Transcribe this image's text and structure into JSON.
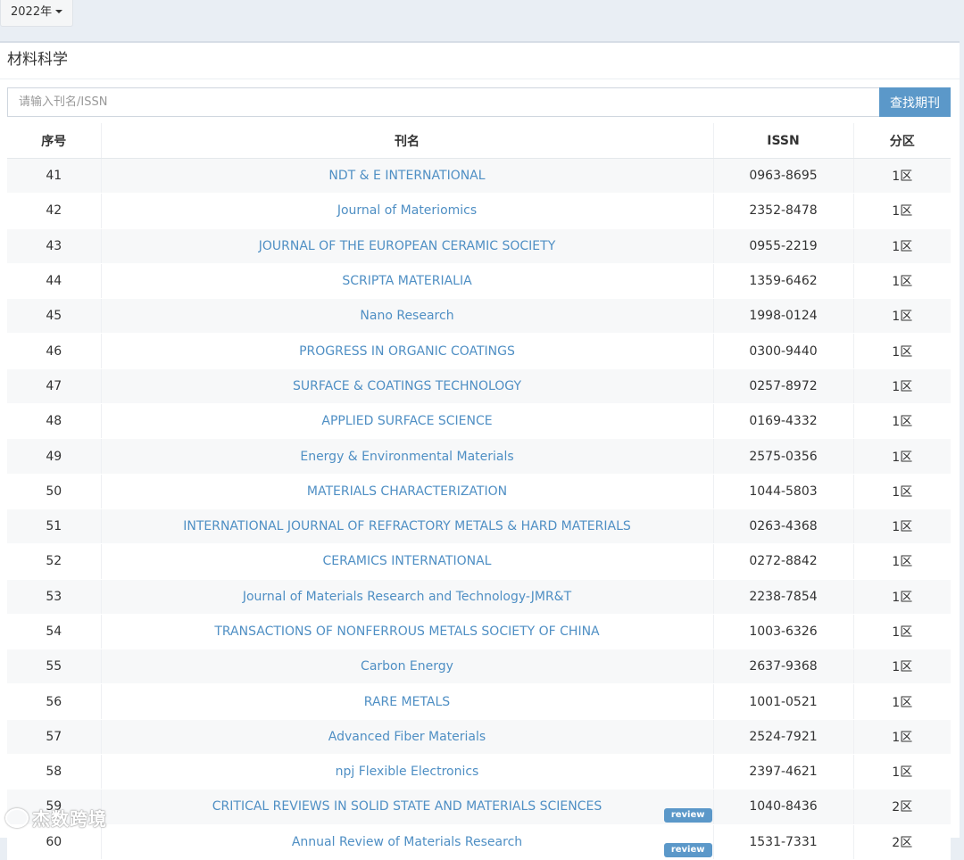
{
  "topbar": {
    "year_label": "2022年"
  },
  "panel": {
    "title": "材料科学"
  },
  "search": {
    "placeholder": "请输入刊名/ISSN",
    "button_label": "查找期刊"
  },
  "table": {
    "headers": {
      "idx": "序号",
      "name": "刊名",
      "issn": "ISSN",
      "zone": "分区"
    },
    "rows": [
      {
        "idx": "41",
        "name": "NDT & E INTERNATIONAL",
        "issn": "0963-8695",
        "zone": "1区"
      },
      {
        "idx": "42",
        "name": "Journal of Materiomics",
        "issn": "2352-8478",
        "zone": "1区"
      },
      {
        "idx": "43",
        "name": "JOURNAL OF THE EUROPEAN CERAMIC SOCIETY",
        "issn": "0955-2219",
        "zone": "1区"
      },
      {
        "idx": "44",
        "name": "SCRIPTA MATERIALIA",
        "issn": "1359-6462",
        "zone": "1区"
      },
      {
        "idx": "45",
        "name": "Nano Research",
        "issn": "1998-0124",
        "zone": "1区"
      },
      {
        "idx": "46",
        "name": "PROGRESS IN ORGANIC COATINGS",
        "issn": "0300-9440",
        "zone": "1区"
      },
      {
        "idx": "47",
        "name": "SURFACE & COATINGS TECHNOLOGY",
        "issn": "0257-8972",
        "zone": "1区"
      },
      {
        "idx": "48",
        "name": "APPLIED SURFACE SCIENCE",
        "issn": "0169-4332",
        "zone": "1区"
      },
      {
        "idx": "49",
        "name": "Energy & Environmental Materials",
        "issn": "2575-0356",
        "zone": "1区"
      },
      {
        "idx": "50",
        "name": "MATERIALS CHARACTERIZATION",
        "issn": "1044-5803",
        "zone": "1区"
      },
      {
        "idx": "51",
        "name": "INTERNATIONAL JOURNAL OF REFRACTORY METALS & HARD MATERIALS",
        "issn": "0263-4368",
        "zone": "1区"
      },
      {
        "idx": "52",
        "name": "CERAMICS INTERNATIONAL",
        "issn": "0272-8842",
        "zone": "1区"
      },
      {
        "idx": "53",
        "name": "Journal of Materials Research and Technology-JMR&T",
        "issn": "2238-7854",
        "zone": "1区"
      },
      {
        "idx": "54",
        "name": "TRANSACTIONS OF NONFERROUS METALS SOCIETY OF CHINA",
        "issn": "1003-6326",
        "zone": "1区"
      },
      {
        "idx": "55",
        "name": "Carbon Energy",
        "issn": "2637-9368",
        "zone": "1区"
      },
      {
        "idx": "56",
        "name": "RARE METALS",
        "issn": "1001-0521",
        "zone": "1区"
      },
      {
        "idx": "57",
        "name": "Advanced Fiber Materials",
        "issn": "2524-7921",
        "zone": "1区"
      },
      {
        "idx": "58",
        "name": "npj Flexible Electronics",
        "issn": "2397-4621",
        "zone": "1区"
      },
      {
        "idx": "59",
        "name": "CRITICAL REVIEWS IN SOLID STATE AND MATERIALS SCIENCES",
        "issn": "1040-8436",
        "zone": "2区",
        "badge": "review"
      },
      {
        "idx": "60",
        "name": "Annual Review of Materials Research",
        "issn": "1531-7331",
        "zone": "2区",
        "badge": "review"
      }
    ]
  },
  "watermark": {
    "text": "杰数跨境"
  },
  "colors": {
    "accent": "#5b98c9",
    "link": "#4f8fc4",
    "background": "#e9eef4"
  }
}
